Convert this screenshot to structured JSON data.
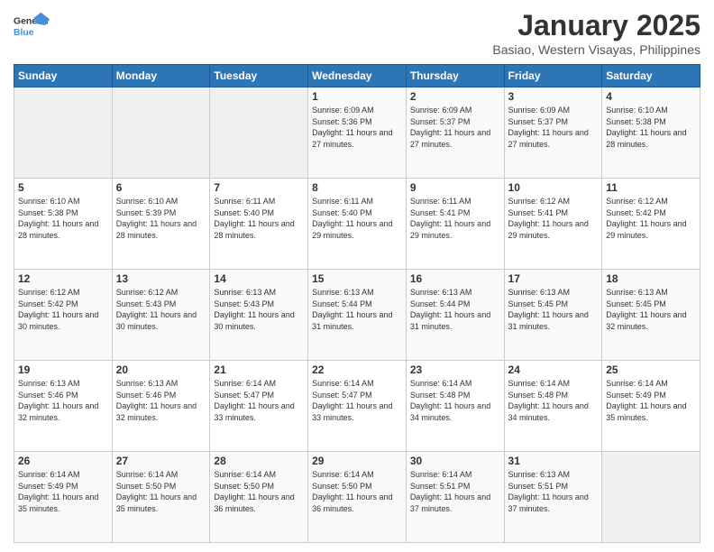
{
  "header": {
    "logo_line1": "General",
    "logo_line2": "Blue",
    "month": "January 2025",
    "location": "Basiao, Western Visayas, Philippines"
  },
  "days_of_week": [
    "Sunday",
    "Monday",
    "Tuesday",
    "Wednesday",
    "Thursday",
    "Friday",
    "Saturday"
  ],
  "weeks": [
    [
      {
        "day": "",
        "info": ""
      },
      {
        "day": "",
        "info": ""
      },
      {
        "day": "",
        "info": ""
      },
      {
        "day": "1",
        "info": "Sunrise: 6:09 AM\nSunset: 5:36 PM\nDaylight: 11 hours and 27 minutes."
      },
      {
        "day": "2",
        "info": "Sunrise: 6:09 AM\nSunset: 5:37 PM\nDaylight: 11 hours and 27 minutes."
      },
      {
        "day": "3",
        "info": "Sunrise: 6:09 AM\nSunset: 5:37 PM\nDaylight: 11 hours and 27 minutes."
      },
      {
        "day": "4",
        "info": "Sunrise: 6:10 AM\nSunset: 5:38 PM\nDaylight: 11 hours and 28 minutes."
      }
    ],
    [
      {
        "day": "5",
        "info": "Sunrise: 6:10 AM\nSunset: 5:38 PM\nDaylight: 11 hours and 28 minutes."
      },
      {
        "day": "6",
        "info": "Sunrise: 6:10 AM\nSunset: 5:39 PM\nDaylight: 11 hours and 28 minutes."
      },
      {
        "day": "7",
        "info": "Sunrise: 6:11 AM\nSunset: 5:40 PM\nDaylight: 11 hours and 28 minutes."
      },
      {
        "day": "8",
        "info": "Sunrise: 6:11 AM\nSunset: 5:40 PM\nDaylight: 11 hours and 29 minutes."
      },
      {
        "day": "9",
        "info": "Sunrise: 6:11 AM\nSunset: 5:41 PM\nDaylight: 11 hours and 29 minutes."
      },
      {
        "day": "10",
        "info": "Sunrise: 6:12 AM\nSunset: 5:41 PM\nDaylight: 11 hours and 29 minutes."
      },
      {
        "day": "11",
        "info": "Sunrise: 6:12 AM\nSunset: 5:42 PM\nDaylight: 11 hours and 29 minutes."
      }
    ],
    [
      {
        "day": "12",
        "info": "Sunrise: 6:12 AM\nSunset: 5:42 PM\nDaylight: 11 hours and 30 minutes."
      },
      {
        "day": "13",
        "info": "Sunrise: 6:12 AM\nSunset: 5:43 PM\nDaylight: 11 hours and 30 minutes."
      },
      {
        "day": "14",
        "info": "Sunrise: 6:13 AM\nSunset: 5:43 PM\nDaylight: 11 hours and 30 minutes."
      },
      {
        "day": "15",
        "info": "Sunrise: 6:13 AM\nSunset: 5:44 PM\nDaylight: 11 hours and 31 minutes."
      },
      {
        "day": "16",
        "info": "Sunrise: 6:13 AM\nSunset: 5:44 PM\nDaylight: 11 hours and 31 minutes."
      },
      {
        "day": "17",
        "info": "Sunrise: 6:13 AM\nSunset: 5:45 PM\nDaylight: 11 hours and 31 minutes."
      },
      {
        "day": "18",
        "info": "Sunrise: 6:13 AM\nSunset: 5:45 PM\nDaylight: 11 hours and 32 minutes."
      }
    ],
    [
      {
        "day": "19",
        "info": "Sunrise: 6:13 AM\nSunset: 5:46 PM\nDaylight: 11 hours and 32 minutes."
      },
      {
        "day": "20",
        "info": "Sunrise: 6:13 AM\nSunset: 5:46 PM\nDaylight: 11 hours and 32 minutes."
      },
      {
        "day": "21",
        "info": "Sunrise: 6:14 AM\nSunset: 5:47 PM\nDaylight: 11 hours and 33 minutes."
      },
      {
        "day": "22",
        "info": "Sunrise: 6:14 AM\nSunset: 5:47 PM\nDaylight: 11 hours and 33 minutes."
      },
      {
        "day": "23",
        "info": "Sunrise: 6:14 AM\nSunset: 5:48 PM\nDaylight: 11 hours and 34 minutes."
      },
      {
        "day": "24",
        "info": "Sunrise: 6:14 AM\nSunset: 5:48 PM\nDaylight: 11 hours and 34 minutes."
      },
      {
        "day": "25",
        "info": "Sunrise: 6:14 AM\nSunset: 5:49 PM\nDaylight: 11 hours and 35 minutes."
      }
    ],
    [
      {
        "day": "26",
        "info": "Sunrise: 6:14 AM\nSunset: 5:49 PM\nDaylight: 11 hours and 35 minutes."
      },
      {
        "day": "27",
        "info": "Sunrise: 6:14 AM\nSunset: 5:50 PM\nDaylight: 11 hours and 35 minutes."
      },
      {
        "day": "28",
        "info": "Sunrise: 6:14 AM\nSunset: 5:50 PM\nDaylight: 11 hours and 36 minutes."
      },
      {
        "day": "29",
        "info": "Sunrise: 6:14 AM\nSunset: 5:50 PM\nDaylight: 11 hours and 36 minutes."
      },
      {
        "day": "30",
        "info": "Sunrise: 6:14 AM\nSunset: 5:51 PM\nDaylight: 11 hours and 37 minutes."
      },
      {
        "day": "31",
        "info": "Sunrise: 6:13 AM\nSunset: 5:51 PM\nDaylight: 11 hours and 37 minutes."
      },
      {
        "day": "",
        "info": ""
      }
    ]
  ]
}
